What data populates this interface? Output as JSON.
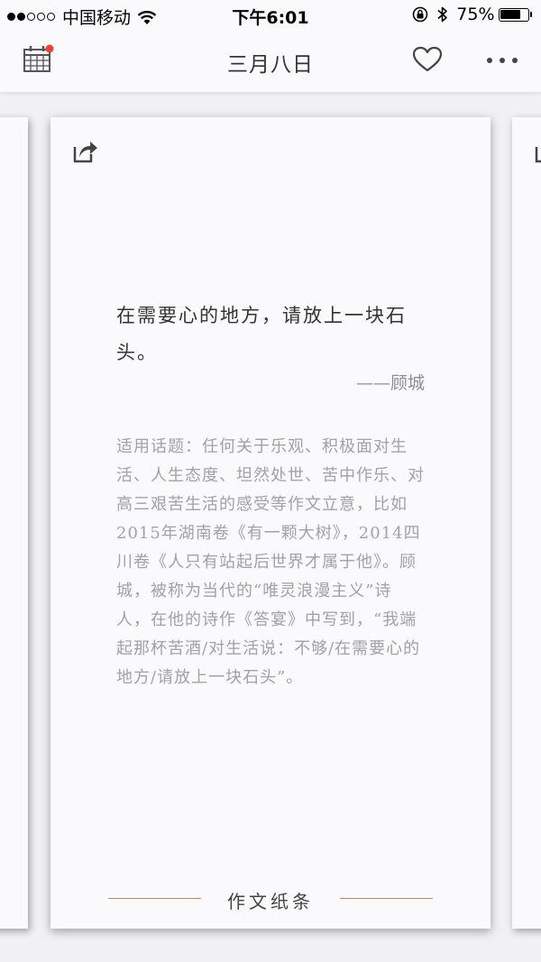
{
  "status_bar": {
    "carrier": "中国移动",
    "time": "下午6:01",
    "battery_percent": "75%",
    "battery_level": 0.75,
    "signal_bars_filled": 2,
    "signal_bars_total": 5
  },
  "nav": {
    "title": "三月八日",
    "calendar_icon": "calendar-icon",
    "favorite_icon": "heart-icon",
    "more_icon": "more-icon",
    "notification_dot_color": "#e8443a"
  },
  "card": {
    "share_icon": "share-icon",
    "quote": "在需要心的地方，请放上一块石头。",
    "author": "——顾城",
    "body": "适用话题：任何关于乐观、积极面对生活、人生态度、坦然处世、苦中作乐、对高三艰苦生活的感受等作文立意，比如2015年湖南卷《有一颗大树》，2014四川卷《人只有站起后世界才属于他》。顾城，被称为当代的“唯灵浪漫主义”诗人，在他的诗作《答宴》中写到，“我端起那杯苦酒/对生活说：不够/在需要心的地方/请放上一块石头”。",
    "footer": "作文纸条",
    "accent_color": "#b38f6f"
  }
}
